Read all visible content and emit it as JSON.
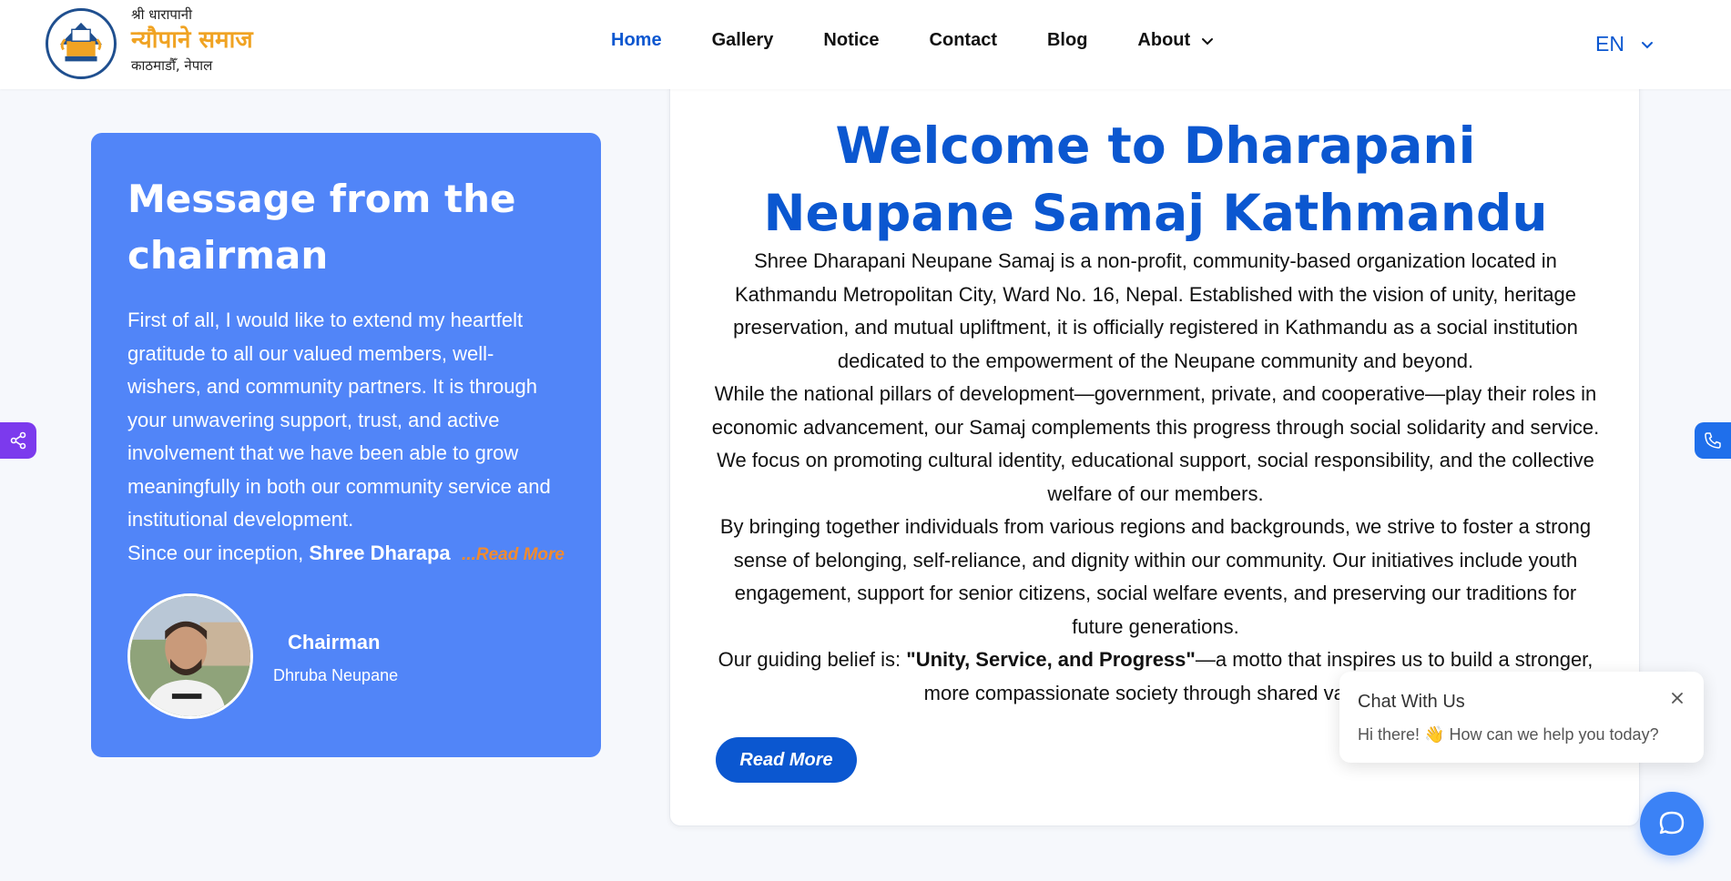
{
  "brand": {
    "line1": "श्री धारापानी",
    "line2": "न्यौपाने समाज",
    "line3": "काठमाडौँ, नेपाल"
  },
  "nav": {
    "items": [
      {
        "label": "Home",
        "active": true
      },
      {
        "label": "Gallery"
      },
      {
        "label": "Notice"
      },
      {
        "label": "Contact"
      },
      {
        "label": "Blog"
      },
      {
        "label": "About"
      }
    ],
    "language": "EN"
  },
  "chairman": {
    "title": "Message from the chairman",
    "message": "First of all, I would like to extend my heartfelt gratitude to all our valued members, well-wishers, and community partners. It is through your unwavering support, trust, and active involvement that we have been able to grow meaningfully in both our community service and institutional development.",
    "last_line_prefix": "Since our inception, ",
    "last_line_bold": "Shree Dharapani",
    "read_more": "...Read More",
    "role": "Chairman",
    "name": "Dhruba Neupane"
  },
  "welcome": {
    "title": "Welcome to Dharapani Neupane Samaj Kathmandu",
    "p1": "Shree Dharapani Neupane Samaj is a non-profit, community-based organization located in Kathmandu Metropolitan City, Ward No. 16, Nepal. Established with the vision of unity, heritage preservation, and mutual upliftment, it is officially registered in Kathmandu as a social institution dedicated to the empowerment of the Neupane community and beyond.",
    "p2": "While the national pillars of development—government, private, and cooperative—play their roles in economic advancement, our Samaj complements this progress through social solidarity and service. We focus on promoting cultural identity, educational support, social responsibility, and the collective welfare of our members.",
    "p3": "By bringing together individuals from various regions and backgrounds, we strive to foster a strong sense of belonging, self-reliance, and dignity within our community. Our initiatives include youth engagement, support for senior citizens, social welfare events, and preserving our traditions for future generations.",
    "p4_prefix": "Our guiding belief is: ",
    "p4_bold": "\"Unity, Service, and Progress\"",
    "p4_suffix": "—a motto that inspires us to build a stronger, more compassionate society through shared values.",
    "button": "Read More"
  },
  "chat": {
    "title": "Chat With Us",
    "subtitle": "Hi there! 👋 How can we help you today?"
  },
  "colors": {
    "primary": "#0b57d0",
    "card_blue": "#5185f8",
    "accent_orange": "#f28b2e",
    "brand_gold": "#f0a323",
    "share_purple": "#7c3aed"
  },
  "icons": [
    "share-icon",
    "phone-icon",
    "chat-icon",
    "close-icon",
    "chevron-down-icon"
  ]
}
